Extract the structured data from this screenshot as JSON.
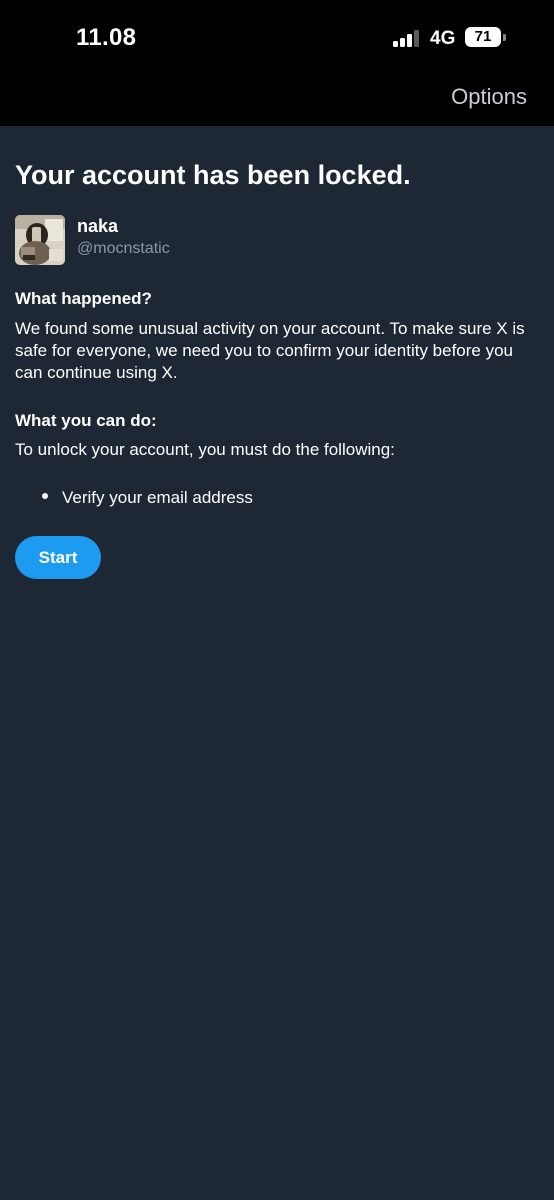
{
  "status_bar": {
    "time": "11.08",
    "network": "4G",
    "battery": "71"
  },
  "header": {
    "options_label": "Options"
  },
  "main": {
    "title": "Your account has been locked.",
    "user": {
      "name": "naka",
      "handle": "@mocnstatic"
    },
    "what_happened": {
      "heading": "What happened?",
      "text": "We found some unusual activity on your account. To make sure X is safe for everyone, we need you to confirm your identity before you can continue using X."
    },
    "what_you_can_do": {
      "heading": "What you can do:",
      "text": "To unlock your account, you must do the following:",
      "items": [
        "Verify your email address"
      ]
    },
    "start_button": "Start"
  },
  "colors": {
    "background": "#1e2734",
    "topbar": "#000000",
    "accent": "#1d9bf0",
    "muted_text": "#8b98a5"
  }
}
